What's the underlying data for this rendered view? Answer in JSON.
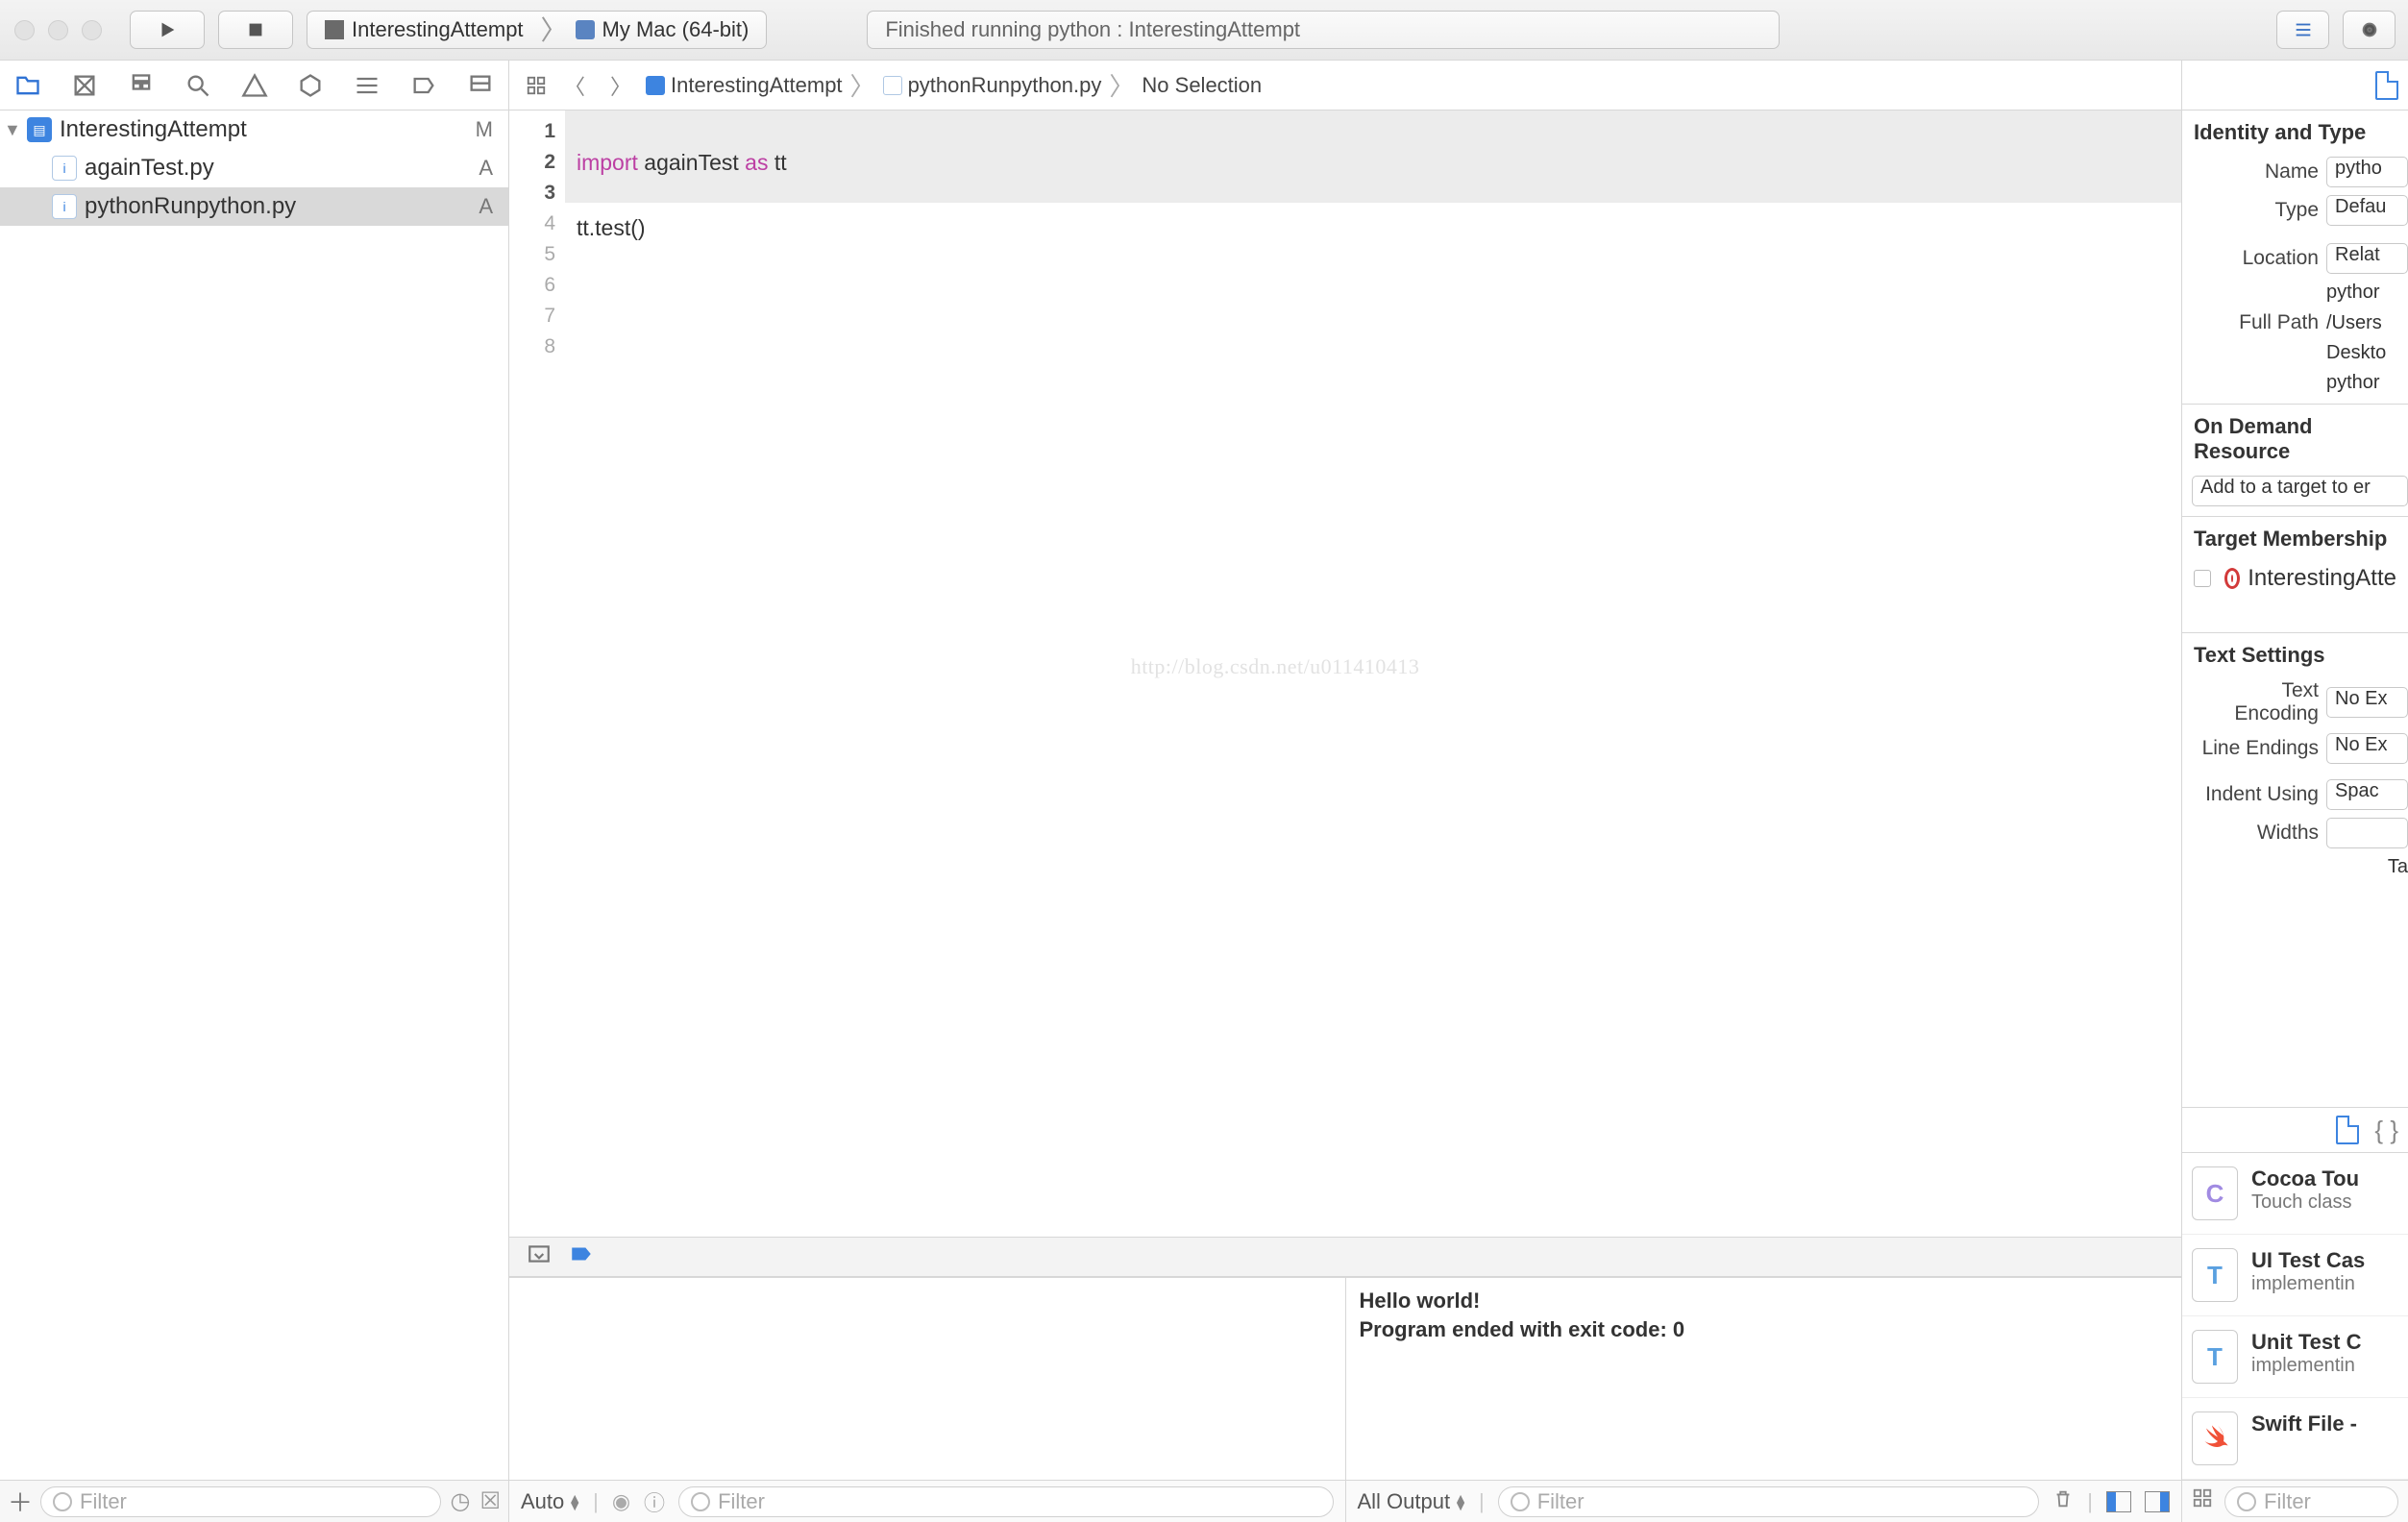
{
  "toolbar": {
    "scheme_project": "InterestingAttempt",
    "scheme_device": "My Mac (64-bit)",
    "status_text": "Finished running python : InterestingAttempt"
  },
  "navigator": {
    "filter_placeholder": "Filter",
    "tree": {
      "root": {
        "name": "InterestingAttempt",
        "status": "M"
      },
      "files": [
        {
          "name": "againTest.py",
          "status": "A",
          "selected": false
        },
        {
          "name": "pythonRunpython.py",
          "status": "A",
          "selected": true
        }
      ]
    }
  },
  "jumpbar": {
    "crumb1": "InterestingAttempt",
    "crumb2": "pythonRunpython.py",
    "crumb3": "No Selection"
  },
  "editor": {
    "lines": {
      "l1a": "import",
      "l1b": " againTest ",
      "l1c": "as",
      "l1d": " tt",
      "l3": "tt.test()"
    },
    "gutter": [
      "1",
      "2",
      "3",
      "4",
      "5",
      "6",
      "7",
      "8"
    ],
    "watermark": "http://blog.csdn.net/u011410413"
  },
  "console": {
    "line1": "Hello world!",
    "line2": "Program ended with exit code: 0"
  },
  "debug": {
    "auto_label": "Auto",
    "all_output_label": "All Output",
    "filter_placeholder": "Filter"
  },
  "inspector": {
    "sections": {
      "identity_title": "Identity and Type",
      "name_label": "Name",
      "name_value": "pytho",
      "type_label": "Type",
      "type_value": "Defau",
      "location_label": "Location",
      "location_value": "Relat",
      "location_path": "pythor",
      "fullpath_label": "Full Path",
      "fullpath_value1": "/Users",
      "fullpath_value2": "Deskto",
      "fullpath_value3": "pythor",
      "odr_title": "On Demand Resource",
      "odr_placeholder": "Add to a target to er",
      "target_title": "Target Membership",
      "target_name": "InterestingAtte",
      "text_title": "Text Settings",
      "enc_label": "Text Encoding",
      "enc_value": "No Ex",
      "le_label": "Line Endings",
      "le_value": "No Ex",
      "indent_label": "Indent Using",
      "indent_value": "Spac",
      "widths_label": "Widths",
      "ta_label": "Ta"
    },
    "library": [
      {
        "title": "Cocoa Tou",
        "sub": "Touch class",
        "letter": "C",
        "cls": "c"
      },
      {
        "title": "UI Test Cas",
        "sub": "implementin",
        "letter": "T",
        "cls": "t"
      },
      {
        "title": "Unit Test C",
        "sub": "implementin",
        "letter": "T",
        "cls": "t"
      },
      {
        "title": "Swift File -",
        "sub": "",
        "letter": "",
        "cls": "s"
      }
    ],
    "filter_placeholder": "Filter"
  }
}
